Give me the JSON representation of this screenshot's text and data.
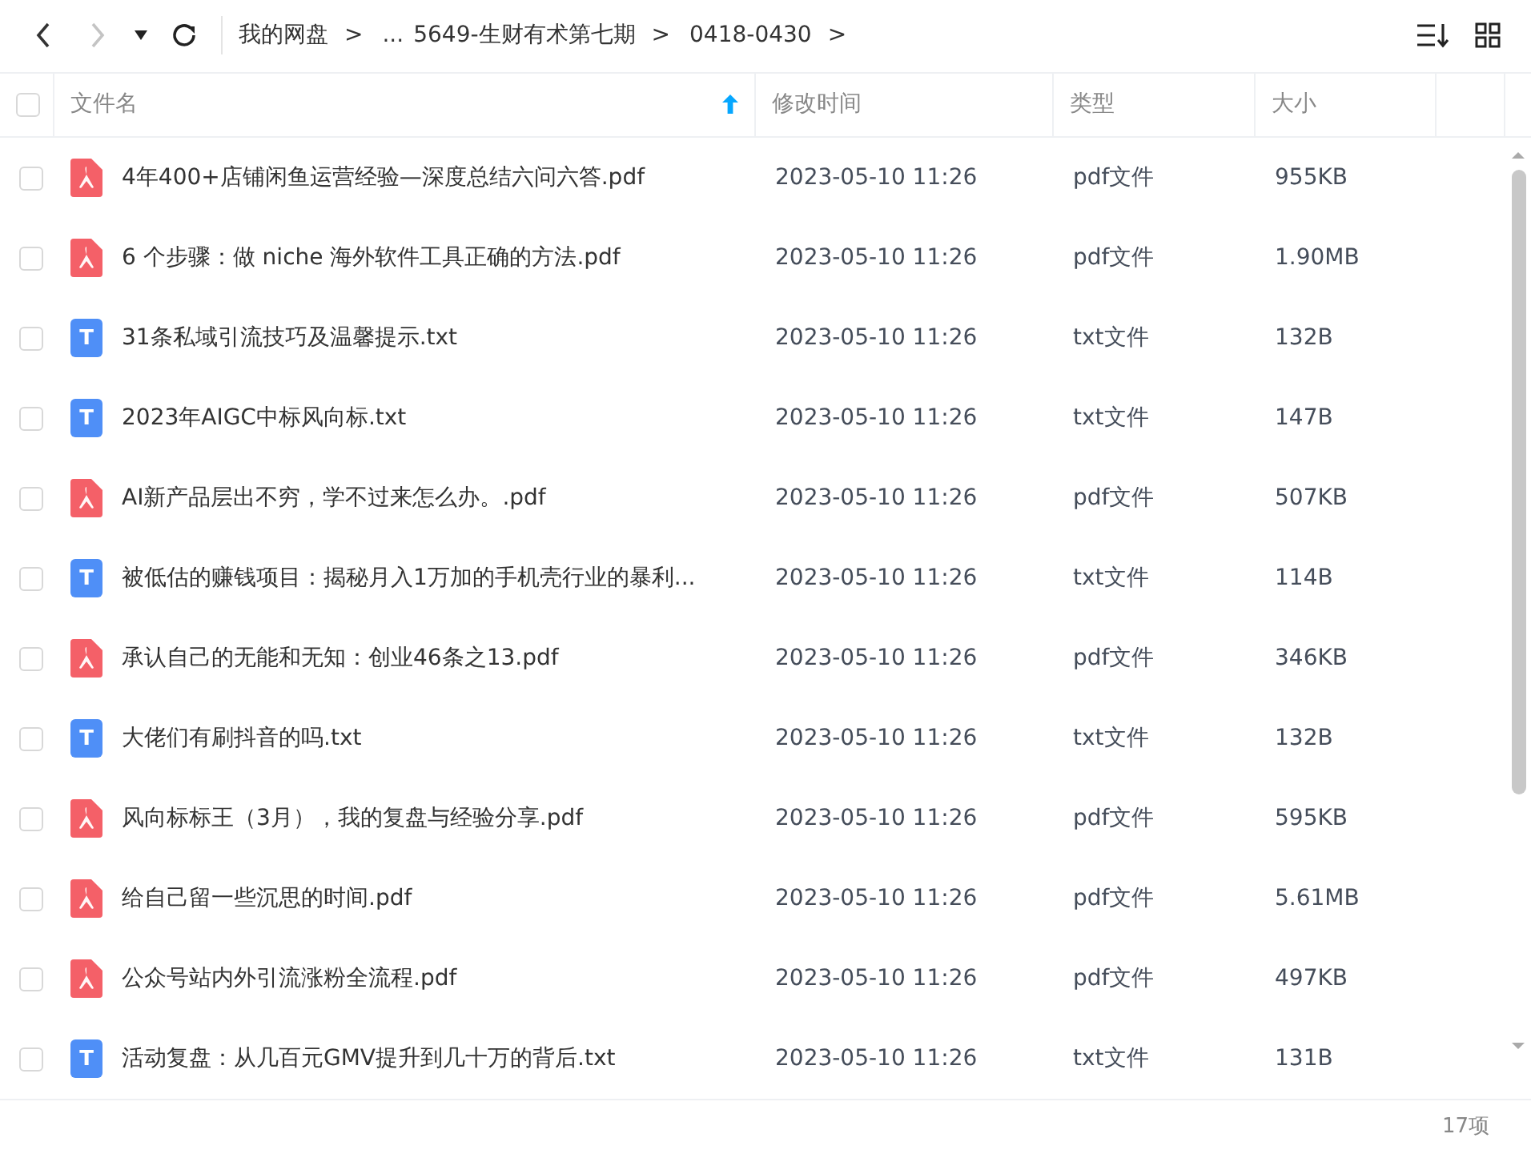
{
  "breadcrumb": [
    {
      "label": "我的网盘",
      "separator": ">"
    },
    {
      "label": "..."
    },
    {
      "label": "5649-生财有术第七期",
      "separator": ">"
    },
    {
      "label": "0418-0430",
      "separator": ">"
    }
  ],
  "nav": {
    "back_disabled": false,
    "forward_disabled": true
  },
  "columns": [
    {
      "label": "文件名",
      "sorted": true
    },
    {
      "label": "修改时间",
      "sorted": false
    },
    {
      "label": "类型",
      "sorted": false
    },
    {
      "label": "大小",
      "sorted": false
    }
  ],
  "header_checked": false,
  "rows": [
    {
      "kind": "pdf",
      "name": "4年400+店铺闲鱼运营经验—深度总结六问六答.pdf",
      "modified": "2023-05-10 11:26",
      "type": "pdf文件",
      "size": "955KB",
      "checked": false
    },
    {
      "kind": "pdf",
      "name": "6 个步骤：做 niche 海外软件工具正确的方法.pdf",
      "modified": "2023-05-10 11:26",
      "type": "pdf文件",
      "size": "1.90MB",
      "checked": false
    },
    {
      "kind": "txt",
      "icon_text": "T",
      "name": "31条私域引流技巧及温馨提示.txt",
      "modified": "2023-05-10 11:26",
      "type": "txt文件",
      "size": "132B",
      "checked": false
    },
    {
      "kind": "txt",
      "icon_text": "T",
      "name": "2023年AIGC中标风向标.txt",
      "modified": "2023-05-10 11:26",
      "type": "txt文件",
      "size": "147B",
      "checked": false
    },
    {
      "kind": "pdf",
      "name": "AI新产品层出不穷，学不过来怎么办。.pdf",
      "modified": "2023-05-10 11:26",
      "type": "pdf文件",
      "size": "507KB",
      "checked": false
    },
    {
      "kind": "txt",
      "icon_text": "T",
      "name": "被低估的赚钱项目：揭秘月入1万加的手机壳行业的暴利...",
      "modified": "2023-05-10 11:26",
      "type": "txt文件",
      "size": "114B",
      "checked": false
    },
    {
      "kind": "pdf",
      "name": "承认自己的无能和无知：创业46条之13.pdf",
      "modified": "2023-05-10 11:26",
      "type": "pdf文件",
      "size": "346KB",
      "checked": false
    },
    {
      "kind": "txt",
      "icon_text": "T",
      "name": "大佬们有刷抖音的吗.txt",
      "modified": "2023-05-10 11:26",
      "type": "txt文件",
      "size": "132B",
      "checked": false
    },
    {
      "kind": "pdf",
      "name": "风向标标王（3月），我的复盘与经验分享.pdf",
      "modified": "2023-05-10 11:26",
      "type": "pdf文件",
      "size": "595KB",
      "checked": false
    },
    {
      "kind": "pdf",
      "name": "给自己留一些沉思的时间.pdf",
      "modified": "2023-05-10 11:26",
      "type": "pdf文件",
      "size": "5.61MB",
      "checked": false
    },
    {
      "kind": "pdf",
      "name": "公众号站内外引流涨粉全流程.pdf",
      "modified": "2023-05-10 11:26",
      "type": "pdf文件",
      "size": "497KB",
      "checked": false
    },
    {
      "kind": "txt",
      "icon_text": "T",
      "name": "活动复盘：从几百元GMV提升到几十万的背后.txt",
      "modified": "2023-05-10 11:26",
      "type": "txt文件",
      "size": "131B",
      "checked": false
    }
  ],
  "status_bar": {
    "count": "17项"
  }
}
